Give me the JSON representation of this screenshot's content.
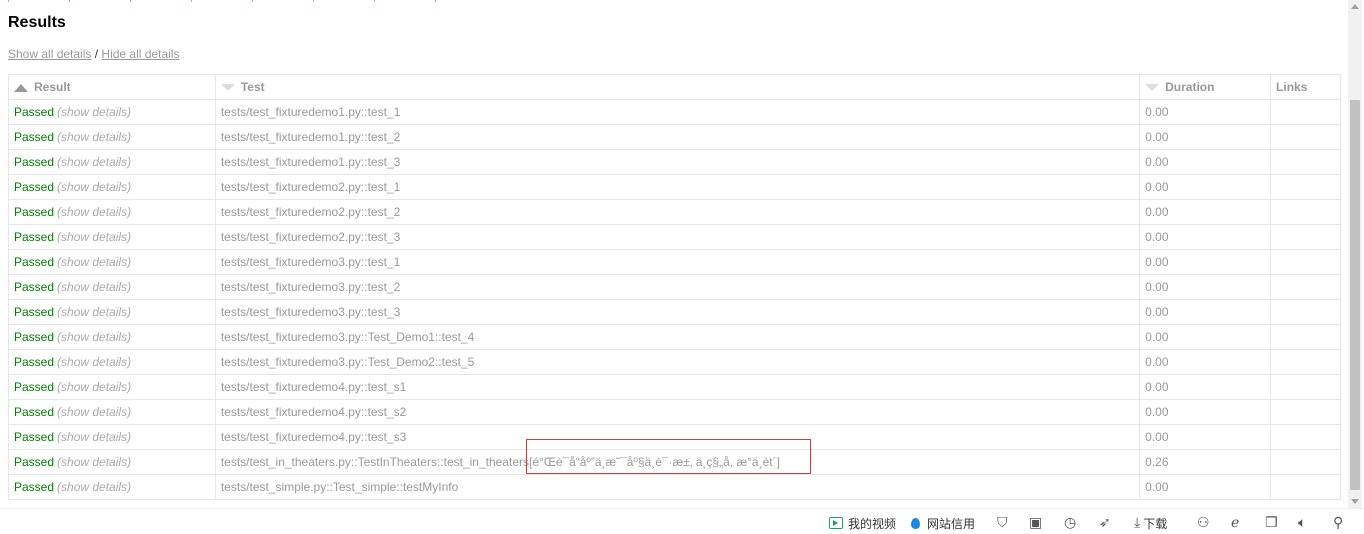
{
  "page": {
    "title": "Results",
    "show_all_details": "Show all details",
    "separator": " / ",
    "hide_all_details": "Hide all details"
  },
  "table": {
    "headers": {
      "result": "Result",
      "test": "Test",
      "duration": "Duration",
      "links": "Links"
    },
    "rows": [
      {
        "result": "Passed",
        "details": "(show details)",
        "test": "tests/test_fixturedemo1.py::test_1",
        "duration": "0.00",
        "links": ""
      },
      {
        "result": "Passed",
        "details": "(show details)",
        "test": "tests/test_fixturedemo1.py::test_2",
        "duration": "0.00",
        "links": ""
      },
      {
        "result": "Passed",
        "details": "(show details)",
        "test": "tests/test_fixturedemo1.py::test_3",
        "duration": "0.00",
        "links": ""
      },
      {
        "result": "Passed",
        "details": "(show details)",
        "test": "tests/test_fixturedemo2.py::test_1",
        "duration": "0.00",
        "links": ""
      },
      {
        "result": "Passed",
        "details": "(show details)",
        "test": "tests/test_fixturedemo2.py::test_2",
        "duration": "0.00",
        "links": ""
      },
      {
        "result": "Passed",
        "details": "(show details)",
        "test": "tests/test_fixturedemo2.py::test_3",
        "duration": "0.00",
        "links": ""
      },
      {
        "result": "Passed",
        "details": "(show details)",
        "test": "tests/test_fixturedemo3.py::test_1",
        "duration": "0.00",
        "links": ""
      },
      {
        "result": "Passed",
        "details": "(show details)",
        "test": "tests/test_fixturedemo3.py::test_2",
        "duration": "0.00",
        "links": ""
      },
      {
        "result": "Passed",
        "details": "(show details)",
        "test": "tests/test_fixturedemo3.py::test_3",
        "duration": "0.00",
        "links": ""
      },
      {
        "result": "Passed",
        "details": "(show details)",
        "test": "tests/test_fixturedemo3.py::Test_Demo1::test_4",
        "duration": "0.00",
        "links": ""
      },
      {
        "result": "Passed",
        "details": "(show details)",
        "test": "tests/test_fixturedemo3.py::Test_Demo2::test_5",
        "duration": "0.00",
        "links": ""
      },
      {
        "result": "Passed",
        "details": "(show details)",
        "test": "tests/test_fixturedemo4.py::test_s1",
        "duration": "0.00",
        "links": ""
      },
      {
        "result": "Passed",
        "details": "(show details)",
        "test": "tests/test_fixturedemo4.py::test_s2",
        "duration": "0.00",
        "links": ""
      },
      {
        "result": "Passed",
        "details": "(show details)",
        "test": "tests/test_fixturedemo4.py::test_s3",
        "duration": "0.00",
        "links": ""
      },
      {
        "result": "Passed",
        "details": "(show details)",
        "test": "tests/test_in_theaters.py::TestInTheaters::test_in_theaters[é°Œè¯å“åº”ä¸æ˜¯åº§ä¸è¯·æ±‚ ä¸ç§„å, æ°ä¸èt´]",
        "duration": "0.26",
        "links": ""
      },
      {
        "result": "Passed",
        "details": "(show details)",
        "test": "tests/test_simple.py::Test_simple::testMyInfo",
        "duration": "0.00",
        "links": ""
      }
    ]
  },
  "statusbar": {
    "my_videos": "我的视频",
    "site_credit": "网站信用",
    "download": "下载",
    "icons": [
      "video-icon",
      "drop-icon",
      "shield-icon",
      "image-icon",
      "speed-icon",
      "rocket-icon",
      "download-icon",
      "game-icon",
      "ie-icon",
      "window-icon",
      "speaker-icon",
      "search-icon"
    ]
  },
  "colors": {
    "passed": "#008000",
    "muted": "#999999",
    "highlight": "#d43b3b"
  }
}
